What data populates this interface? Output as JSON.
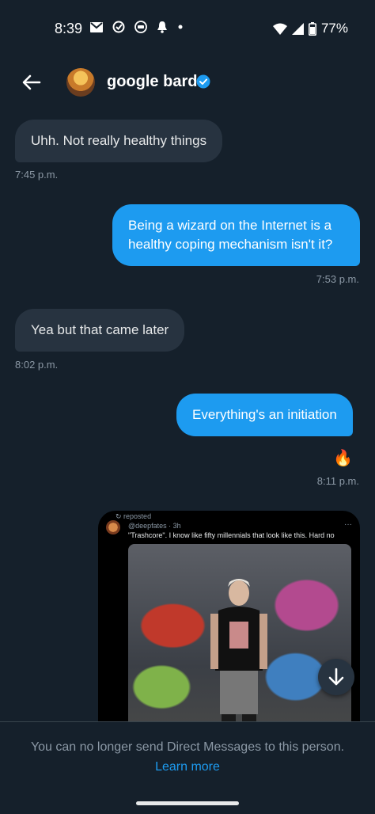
{
  "status_bar": {
    "time": "8:39",
    "battery": "77%",
    "icons": [
      "gmail-icon",
      "check-circle-icon",
      "mask-icon",
      "bell-icon",
      "dot-icon",
      "wifi-icon",
      "signal-icon",
      "battery-icon"
    ]
  },
  "header": {
    "title": "google bard",
    "verified_color": "#1d9bf0"
  },
  "messages": [
    {
      "side": "in",
      "text": "Uhh. Not really healthy things",
      "time": "7:45 p.m."
    },
    {
      "side": "out",
      "text": "Being a wizard on the Internet is a healthy coping mechanism isn't it?",
      "time": "7:53 p.m."
    },
    {
      "side": "in",
      "text": "Yea but that came later",
      "time": "8:02 p.m."
    },
    {
      "side": "out",
      "text": "Everything's an initiation",
      "reaction": "🔥",
      "time": "8:11 p.m."
    }
  ],
  "shared_post": {
    "repost_label": "reposted",
    "handle": "@deepfates · 3h",
    "text": "\"Trashcore\". I know like fifty millennials that look like this. Hard no"
  },
  "footer": {
    "notice": "You can no longer send Direct Messages to this person.",
    "learn_more": "Learn more"
  },
  "colors": {
    "background": "#15202b",
    "incoming_bubble": "#273340",
    "outgoing_bubble": "#1d9bf0",
    "muted_text": "#8b98a5"
  }
}
